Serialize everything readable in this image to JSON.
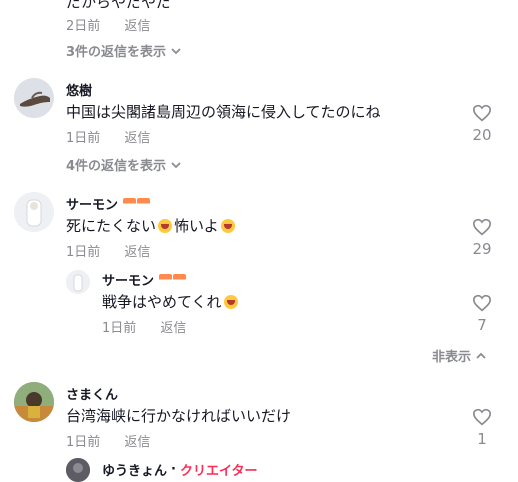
{
  "top": {
    "partial_text": "だからやだやだ",
    "meta": {
      "time": "2日前",
      "reply": "返信"
    },
    "more_replies": "3件の返信を表示"
  },
  "comments": [
    {
      "username": "悠樹",
      "text": "中国は尖閣諸島周辺の領海に侵入してたのにね",
      "time": "1日前",
      "reply": "返信",
      "likes": "20",
      "more_replies": "4件の返信を表示"
    },
    {
      "username": "サーモン",
      "text1": "死にたくない",
      "text2": "怖いよ",
      "time": "1日前",
      "reply": "返信",
      "likes": "29",
      "replies": [
        {
          "username": "サーモン",
          "text": "戦争はやめてくれ",
          "time": "1日前",
          "reply": "返信",
          "likes": "7"
        }
      ],
      "hide_label": "非表示"
    },
    {
      "username": "さまくん",
      "text": "台湾海峡に行かなければいいだけ",
      "time": "1日前",
      "reply": "返信",
      "likes": "1",
      "replies": [
        {
          "username": "ゆうきょん",
          "separator": "·",
          "badge": "クリエイター"
        }
      ]
    }
  ],
  "colors": {
    "accent": "#fe2c55",
    "muted": "#8a8b91",
    "text": "#161823"
  },
  "icons": {
    "like": "heart-outline-icon",
    "expand": "chevron-down-icon",
    "collapse": "chevron-up-icon",
    "emoji_cry": "crying-face-emoji",
    "sushi": "salmon-sushi-emoji"
  }
}
